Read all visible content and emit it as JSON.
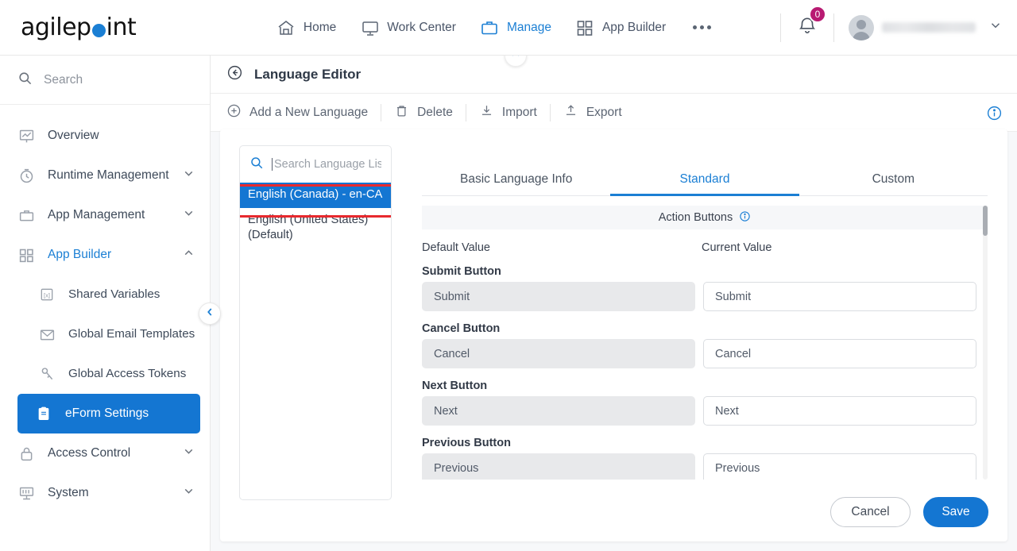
{
  "topbar": {
    "logo_text_1": "agilep",
    "logo_dot": "o",
    "logo_text_2": "int",
    "nav": [
      {
        "label": "Home",
        "icon": "home-icon",
        "active": false
      },
      {
        "label": "Work Center",
        "icon": "monitor-icon",
        "active": false
      },
      {
        "label": "Manage",
        "icon": "briefcase-icon",
        "active": true
      },
      {
        "label": "App Builder",
        "icon": "grid-icon",
        "active": false
      }
    ],
    "more_label": "more-menu",
    "notification_count": "0",
    "user_name": "",
    "accent_color": "#1b7fd4",
    "badge_color": "#b81a72"
  },
  "sidebar": {
    "search_placeholder": "Search",
    "items": [
      {
        "label": "Overview",
        "icon": "chart-board-icon",
        "state": "normal",
        "chevron": ""
      },
      {
        "label": "Runtime Management",
        "icon": "clock-icon",
        "state": "normal",
        "chevron": "down"
      },
      {
        "label": "App Management",
        "icon": "briefcase-icon",
        "state": "normal",
        "chevron": "down"
      },
      {
        "label": "App Builder",
        "icon": "grid-check-icon",
        "state": "blue",
        "chevron": "up"
      },
      {
        "label": "Shared Variables",
        "icon": "variable-icon",
        "state": "sub",
        "chevron": ""
      },
      {
        "label": "Global Email Templates",
        "icon": "envelope-icon",
        "state": "sub",
        "chevron": ""
      },
      {
        "label": "Global Access Tokens",
        "icon": "key-icon",
        "state": "sub",
        "chevron": ""
      },
      {
        "label": "eForm Settings",
        "icon": "clipboard-icon",
        "state": "active",
        "chevron": ""
      },
      {
        "label": "Access Control",
        "icon": "lock-icon",
        "state": "normal",
        "chevron": "down"
      },
      {
        "label": "System",
        "icon": "system-icon",
        "state": "normal",
        "chevron": "down"
      }
    ],
    "collapse_icon": "chevron-left-icon",
    "active_color": "#1476d2"
  },
  "page": {
    "back_icon": "back-arrow-icon",
    "title": "Language Editor",
    "collapse_top_icon": "chevron-up-icon",
    "toolbar": [
      {
        "label": "Add a New Language",
        "icon": "plus-circle-icon"
      },
      {
        "label": "Delete",
        "icon": "trash-icon"
      },
      {
        "label": "Import",
        "icon": "import-icon"
      },
      {
        "label": "Export",
        "icon": "export-icon"
      }
    ],
    "info_icon": "info-circle-icon"
  },
  "language_list": {
    "search_placeholder": "Search Language Lis",
    "search_icon": "search-icon",
    "items": [
      {
        "label": "English (Canada) - en-CA",
        "selected": true,
        "highlighted": true
      },
      {
        "label": "English (United States) (Default)",
        "selected": false,
        "highlighted": false
      }
    ],
    "highlight_color": "#e8292e"
  },
  "tabs": [
    {
      "label": "Basic Language Info",
      "active": false
    },
    {
      "label": "Standard",
      "active": true
    },
    {
      "label": "Custom",
      "active": false
    }
  ],
  "form": {
    "section_title": "Action Buttons",
    "section_info_icon": "info-circle-icon",
    "col_default": "Default Value",
    "col_current": "Current Value",
    "rows": [
      {
        "label": "Submit Button",
        "default_value": "Submit",
        "current_value": "Submit"
      },
      {
        "label": "Cancel Button",
        "default_value": "Cancel",
        "current_value": "Cancel"
      },
      {
        "label": "Next Button",
        "default_value": "Next",
        "current_value": "Next"
      },
      {
        "label": "Previous Button",
        "default_value": "Previous",
        "current_value": "Previous"
      }
    ]
  },
  "footer": {
    "cancel_label": "Cancel",
    "save_label": "Save"
  }
}
